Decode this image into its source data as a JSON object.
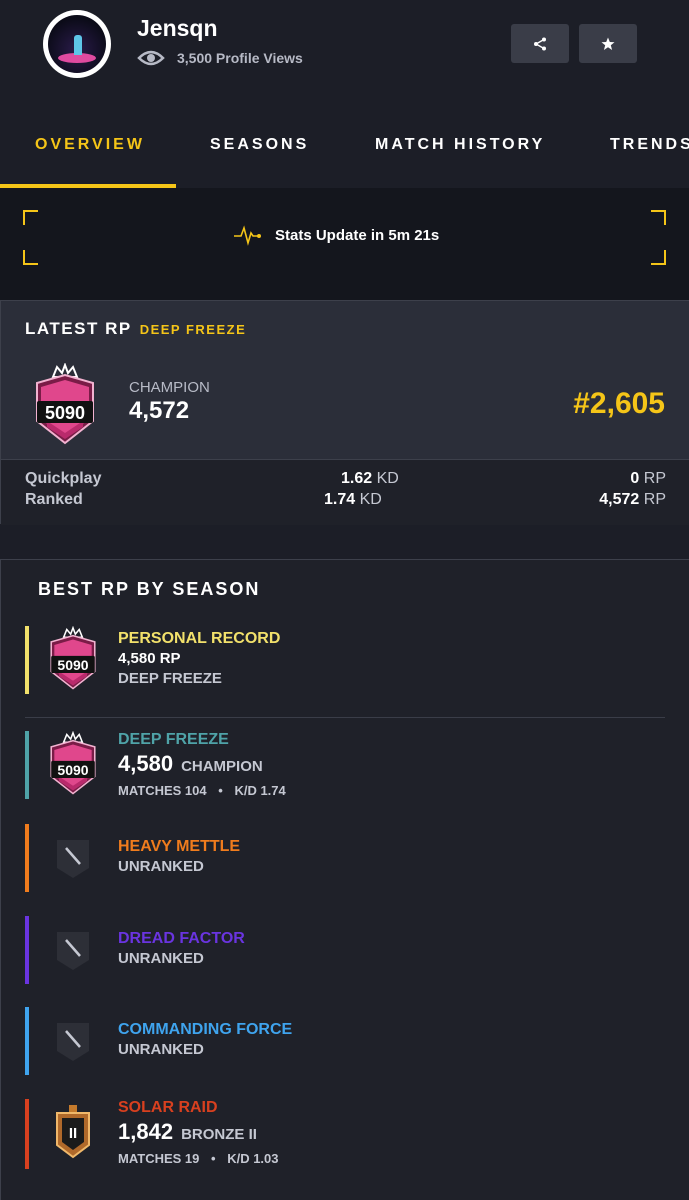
{
  "profile": {
    "username": "Jensqn",
    "views": "3,500 Profile Views"
  },
  "header": {
    "share_icon": "share-icon",
    "favorite_icon": "star-icon"
  },
  "tabs": [
    {
      "label": "OVERVIEW",
      "active": true
    },
    {
      "label": "SEASONS",
      "active": false
    },
    {
      "label": "MATCH HISTORY",
      "active": false
    },
    {
      "label": "TRENDS",
      "active": false
    }
  ],
  "update": {
    "icon": "pulse-icon",
    "text": "Stats Update in 5m 21s"
  },
  "latest": {
    "title": "LATEST RP",
    "season": "DEEP FREEZE",
    "badge_number": "5090",
    "rank_name": "CHAMPION",
    "rank_value": "4,572",
    "leaderboard": "#2,605",
    "modes": [
      {
        "label": "Quickplay",
        "kd": "1.62",
        "kd_unit": "KD",
        "rp": "0",
        "rp_unit": "RP"
      },
      {
        "label": "Ranked",
        "kd": "1.74",
        "kd_unit": "KD",
        "rp": "4,572",
        "rp_unit": "RP"
      }
    ]
  },
  "best": {
    "title": "BEST RP BY SEASON",
    "seasons": [
      {
        "name": "PERSONAL RECORD",
        "color": "#f2e16b",
        "line2": "4,580 RP",
        "line3": "DEEP FREEZE",
        "badge": "5090"
      },
      {
        "name": "DEEP FREEZE",
        "color": "#4fa3a8",
        "rp": "4,580",
        "tier": "CHAMPION",
        "matches": "MATCHES 104",
        "kd": "K/D 1.74",
        "badge": "5090"
      },
      {
        "name": "HEAVY METTLE",
        "color": "#f07c1d",
        "status": "UNRANKED"
      },
      {
        "name": "DREAD FACTOR",
        "color": "#6a34e0",
        "status": "UNRANKED"
      },
      {
        "name": "COMMANDING FORCE",
        "color": "#3fa4ee",
        "status": "UNRANKED"
      },
      {
        "name": "SOLAR RAID",
        "color": "#d8401f",
        "rp": "1,842",
        "tier": "BRONZE II",
        "matches": "MATCHES 19",
        "kd": "K/D 1.03",
        "badge": "II"
      }
    ]
  }
}
